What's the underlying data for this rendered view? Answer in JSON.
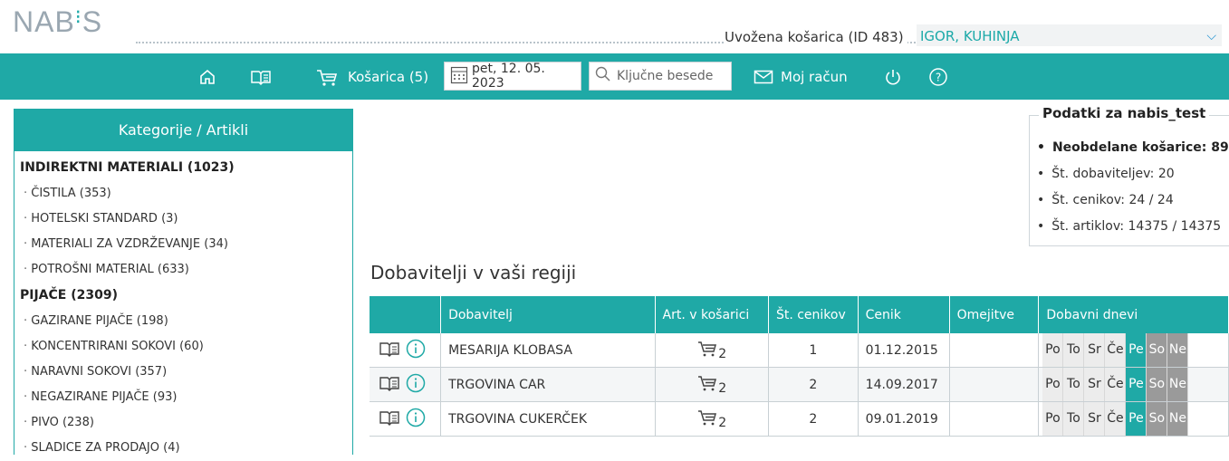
{
  "header": {
    "logo_text": "NAB",
    "logo_tail": "S",
    "basket_info": "Uvožena košarica (ID 483)",
    "user_select": "IGOR, KUHINJA"
  },
  "nav": {
    "basket_label": "Košarica (5)",
    "date_value": "pet, 12. 05. 2023",
    "search_placeholder": "Ključne besede",
    "account_label": "Moj račun",
    "icons": [
      "home-icon",
      "catalog-icon",
      "cart-icon",
      "calendar-icon",
      "search-icon",
      "mail-icon",
      "power-icon",
      "help-icon"
    ]
  },
  "sidebar": {
    "title": "Kategorije / Artikli",
    "groups": [
      {
        "label": "INDIREKTNI MATERIALI (1023)",
        "items": [
          "ČISTILA (353)",
          "HOTELSKI STANDARD (3)",
          "MATERIALI ZA VZDRŽEVANJE (34)",
          "POTROŠNI MATERIAL (633)"
        ]
      },
      {
        "label": "PIJAČE (2309)",
        "items": [
          "GAZIRANE PIJAČE (198)",
          "KONCENTRIRANI SOKOVI (60)",
          "NARAVNI SOKOVI (357)",
          "NEGAZIRANE PIJAČE (93)",
          "PIVO (238)",
          "SLADICE ZA PRODAJO (4)"
        ]
      }
    ]
  },
  "infobox": {
    "title": "Podatki za nabis_test",
    "items": [
      "Neobdelane košarice: 89",
      "Št. dobaviteljev: 20",
      "Št. cenikov: 24 / 24",
      "Št. artiklov: 14375 / 14375"
    ]
  },
  "suppliers": {
    "title": "Dobavitelji v vaši regiji",
    "columns": [
      "",
      "Dobavitelj",
      "Art. v košarici",
      "Št. cenikov",
      "Cenik",
      "Omejitve",
      "Dobavni dnevi"
    ],
    "day_labels": [
      "Po",
      "To",
      "Sr",
      "Če",
      "Pe",
      "So",
      "Ne"
    ],
    "rows": [
      {
        "name": "MESARIJA KLOBASA",
        "in_basket": "2",
        "pricelists": "1",
        "pricelist_date": "01.12.2015",
        "limits": ""
      },
      {
        "name": "TRGOVINA CAR",
        "in_basket": "2",
        "pricelists": "2",
        "pricelist_date": "14.09.2017",
        "limits": ""
      },
      {
        "name": "TRGOVINA CUKERČEK",
        "in_basket": "2",
        "pricelists": "2",
        "pricelist_date": "09.01.2019",
        "limits": ""
      }
    ],
    "day_states": [
      "off",
      "off",
      "off",
      "off",
      "on",
      "closed",
      "closed"
    ]
  },
  "colors": {
    "accent": "#1fa9a6",
    "closed_day": "#9a9a9a"
  }
}
